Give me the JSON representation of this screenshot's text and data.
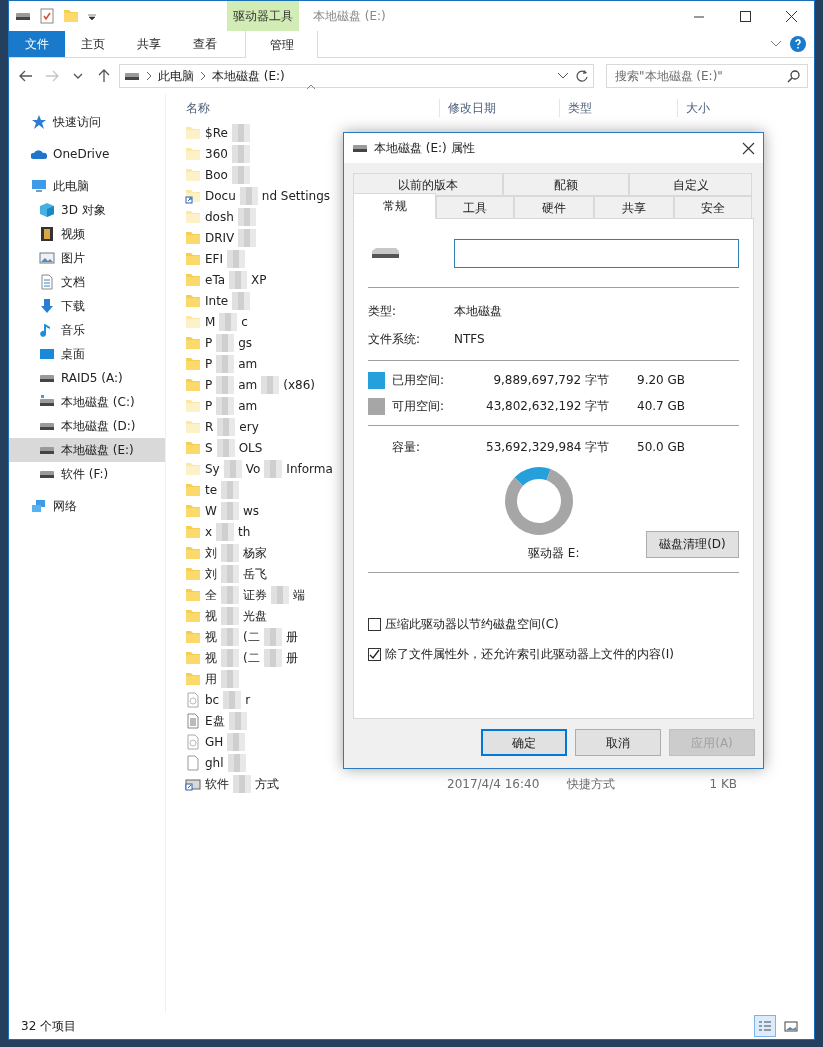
{
  "explorer": {
    "title": "本地磁盘 (E:)",
    "context_group": "驱动器工具",
    "ribbon_tabs": [
      {
        "label": "文件",
        "kind": "file",
        "selected": false
      },
      {
        "label": "主页",
        "kind": "tab",
        "selected": false
      },
      {
        "label": "共享",
        "kind": "tab",
        "selected": false
      },
      {
        "label": "查看",
        "kind": "tab",
        "selected": false
      },
      {
        "label": "管理",
        "kind": "context",
        "selected": true
      }
    ],
    "nav_buttons": [
      {
        "kind": "back",
        "disabled": false
      },
      {
        "kind": "forward",
        "disabled": true
      },
      {
        "kind": "recent",
        "disabled": false
      },
      {
        "kind": "up",
        "disabled": false
      }
    ],
    "address": {
      "crumbs": [
        "此电脑",
        "本地磁盘 (E:)"
      ]
    },
    "search": {
      "placeholder": "搜索\"本地磁盘 (E:)\""
    },
    "sidebar": [
      {
        "label": "快速访问",
        "kind": "star",
        "selected": false
      },
      {
        "label": "OneDrive",
        "kind": "cloud",
        "selected": false
      },
      {
        "label": "此电脑",
        "kind": "pc",
        "selected": false,
        "children": [
          {
            "label": "3D 对象",
            "kind": "cube",
            "selected": false
          },
          {
            "label": "视频",
            "kind": "film",
            "selected": false
          },
          {
            "label": "图片",
            "kind": "image",
            "selected": false
          },
          {
            "label": "文档",
            "kind": "doc",
            "selected": false
          },
          {
            "label": "下载",
            "kind": "download",
            "selected": false
          },
          {
            "label": "音乐",
            "kind": "music",
            "selected": false
          },
          {
            "label": "桌面",
            "kind": "desktop",
            "selected": false
          },
          {
            "label": "RAID5 (A:)",
            "kind": "drive",
            "selected": false
          },
          {
            "label": "本地磁盘 (C:)",
            "kind": "system-drive",
            "selected": false
          },
          {
            "label": "本地磁盘 (D:)",
            "kind": "drive",
            "selected": false
          },
          {
            "label": "本地磁盘 (E:)",
            "kind": "drive",
            "selected": true
          },
          {
            "label": "软件 (F:)",
            "kind": "drive",
            "selected": false
          }
        ]
      },
      {
        "label": "网络",
        "kind": "network",
        "selected": false
      }
    ],
    "columns": [
      "名称",
      "修改日期",
      "类型",
      "大小"
    ],
    "files": [
      {
        "segments": [
          "$Re"
        ],
        "kind": "hidden-folder"
      },
      {
        "segments": [
          "360"
        ],
        "kind": "hidden-folder"
      },
      {
        "segments": [
          "Boo"
        ],
        "kind": "hidden-folder"
      },
      {
        "segments": [
          "Docu",
          "nd Settings"
        ],
        "kind": "link"
      },
      {
        "segments": [
          "dosh"
        ],
        "kind": "hidden-folder"
      },
      {
        "segments": [
          "DRIV"
        ],
        "kind": "folder"
      },
      {
        "segments": [
          "EFI"
        ],
        "kind": "folder"
      },
      {
        "segments": [
          "eTa",
          "XP"
        ],
        "kind": "folder"
      },
      {
        "segments": [
          "Inte"
        ],
        "kind": "folder"
      },
      {
        "segments": [
          "M",
          "c"
        ],
        "kind": "hidden-folder"
      },
      {
        "segments": [
          "P",
          "gs"
        ],
        "kind": "folder"
      },
      {
        "segments": [
          "P",
          "am"
        ],
        "kind": "folder"
      },
      {
        "segments": [
          "P",
          "am",
          "(x86)"
        ],
        "kind": "folder"
      },
      {
        "segments": [
          "P",
          "am"
        ],
        "kind": "hidden-folder"
      },
      {
        "segments": [
          "R",
          "ery"
        ],
        "kind": "hidden-folder"
      },
      {
        "segments": [
          "S",
          "OLS"
        ],
        "kind": "folder"
      },
      {
        "segments": [
          "Sy",
          "Vo",
          "Informa"
        ],
        "kind": "hidden-folder"
      },
      {
        "segments": [
          "te"
        ],
        "kind": "folder"
      },
      {
        "segments": [
          "W",
          "ws"
        ],
        "kind": "folder"
      },
      {
        "segments": [
          "x",
          "th"
        ],
        "kind": "folder"
      },
      {
        "segments": [
          "刘",
          "杨家"
        ],
        "kind": "folder"
      },
      {
        "segments": [
          "刘",
          "岳飞"
        ],
        "kind": "folder"
      },
      {
        "segments": [
          "全",
          "证券",
          "端"
        ],
        "kind": "folder"
      },
      {
        "segments": [
          "视",
          "光盘"
        ],
        "kind": "folder"
      },
      {
        "segments": [
          "视",
          "(二",
          "册"
        ],
        "kind": "folder"
      },
      {
        "segments": [
          "视",
          "(二",
          "册"
        ],
        "kind": "folder"
      },
      {
        "segments": [
          "用"
        ],
        "kind": "folder"
      },
      {
        "segments": [
          "bc",
          "r"
        ],
        "kind": "system-file"
      },
      {
        "segments": [
          "E盘"
        ],
        "kind": "text-file"
      },
      {
        "segments": [
          "GH"
        ],
        "kind": "system-file"
      },
      {
        "segments": [
          "ghl"
        ],
        "kind": "file"
      },
      {
        "segments": [
          "软件",
          "方式"
        ],
        "kind": "shortcut",
        "modified": "2017/4/4 16:40",
        "type": "快捷方式",
        "size": "1 KB"
      }
    ],
    "status": "32 个项目",
    "views": [
      {
        "kind": "details",
        "selected": true
      },
      {
        "kind": "large-icons",
        "selected": false
      }
    ]
  },
  "dialog": {
    "title": "本地磁盘 (E:) 属性",
    "tab_rows": [
      [
        {
          "label": "以前的版本",
          "selected": false
        },
        {
          "label": "配额",
          "selected": false
        },
        {
          "label": "自定义",
          "selected": false
        }
      ],
      [
        {
          "label": "常规",
          "selected": true
        },
        {
          "label": "工具",
          "selected": false
        },
        {
          "label": "硬件",
          "selected": false
        },
        {
          "label": "共享",
          "selected": false
        },
        {
          "label": "安全",
          "selected": false
        }
      ]
    ],
    "properties": [
      {
        "label": "类型:",
        "value": "本地磁盘"
      },
      {
        "label": "文件系统:",
        "value": "NTFS"
      }
    ],
    "spaces": [
      {
        "label": "已用空间:",
        "bytes": "9,889,697,792 字节",
        "size": "9.20 GB",
        "color": "#26a0da"
      },
      {
        "label": "可用空间:",
        "bytes": "43,802,632,192 字节",
        "size": "40.7 GB",
        "color": "#a6a6a6"
      }
    ],
    "capacity": {
      "label": "容量:",
      "bytes": "53,692,329,984 字节",
      "size": "50.0 GB"
    },
    "chart_data": {
      "type": "donut",
      "values": [
        18.4,
        81.6
      ]
    },
    "drive_label": "驱动器 E:",
    "cleanup_button": "磁盘清理(D)",
    "options": [
      {
        "label": "压缩此驱动器以节约磁盘空间(C)",
        "checked": false
      },
      {
        "label": "除了文件属性外，还允许索引此驱动器上文件的内容(I)",
        "checked": true
      }
    ],
    "buttons": [
      {
        "label": "确定",
        "kind": "default",
        "disabled": false
      },
      {
        "label": "取消",
        "kind": "normal",
        "disabled": false
      },
      {
        "label": "应用(A)",
        "kind": "normal",
        "disabled": true
      }
    ]
  }
}
